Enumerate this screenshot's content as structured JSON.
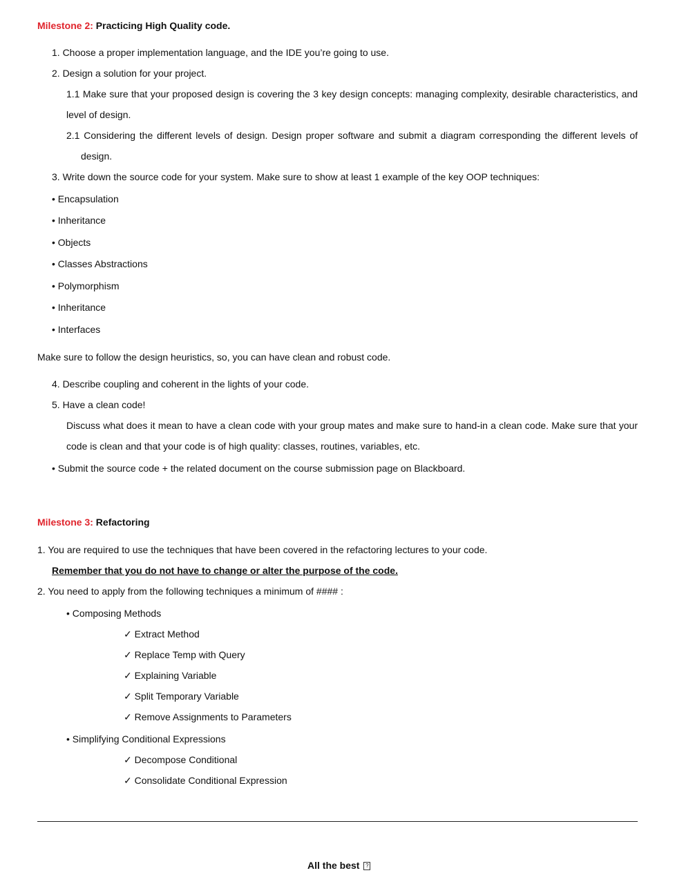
{
  "milestone2": {
    "label": "Milestone 2:",
    "title": "Practicing High Quality code.",
    "items": [
      "1. Choose a proper implementation language, and the IDE you’re going to use.",
      "2. Design a solution for your project."
    ],
    "sub_1_1_line1": "1.1 Make sure that your proposed design is covering the 3 key design concepts: managing complexity, desirable characteristics, and",
    "sub_1_1_line2": "level of design.",
    "sub_2_1_line1": "2.1 Considering the different levels of design. Design proper software and submit a diagram corresponding the different levels of",
    "sub_2_1_line2": "design.",
    "item3": "3. Write down the source code for your system. Make sure to show at least 1 example of the key OOP techniques:",
    "oop_techniques": [
      "• Encapsulation",
      "• Inheritance",
      "• Objects",
      "• Classes Abstractions",
      "• Polymorphism",
      "• Inheritance",
      "• Interfaces"
    ],
    "heuristics_note": "Make sure to follow the design heuristics, so, you can have clean and robust code.",
    "item4": "4. Describe coupling and coherent in the lights of your code.",
    "item5": "5. Have a clean code!",
    "clean_line1": "Discuss what does it mean to have a clean code with your group mates and make sure to hand-in a clean code. Make sure that your",
    "clean_line2": "code is clean and that your code is of high quality: classes, routines, variables, etc.",
    "submit": "• Submit the source code + the related document on the course submission page on Blackboard."
  },
  "milestone3": {
    "label": "Milestone 3:",
    "title": "Refactoring",
    "item1": "1. You are required to use the techniques that have been covered in the refactoring lectures to your code.",
    "reminder": "Remember that you do not have to change or alter the purpose of the code.",
    "item2": "2. You need to apply from the following techniques a minimum of #### :",
    "groups": [
      {
        "name": "• Composing Methods",
        "techniques": [
          "✓ Extract Method",
          "✓ Replace Temp with Query",
          "✓ Explaining Variable",
          "✓ Split Temporary Variable",
          "✓ Remove Assignments to Parameters"
        ]
      },
      {
        "name": "• Simplifying Conditional Expressions",
        "techniques": [
          "✓ Decompose Conditional",
          "✓ Consolidate Conditional Expression"
        ]
      }
    ]
  },
  "footer": {
    "text": "All the best",
    "missing_glyph": "?"
  },
  "colors": {
    "milestone_label": "#e0242c",
    "text": "#111111"
  }
}
